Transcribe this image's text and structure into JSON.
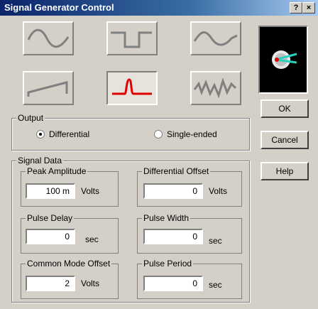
{
  "window": {
    "title": "Signal Generator Control",
    "help_label": "?",
    "close_label": "×"
  },
  "waveforms": [
    {
      "name": "sine",
      "selected": false
    },
    {
      "name": "square",
      "selected": false
    },
    {
      "name": "triangle",
      "selected": false
    },
    {
      "name": "ramp",
      "selected": false
    },
    {
      "name": "pulse",
      "selected": true
    },
    {
      "name": "noise",
      "selected": false
    }
  ],
  "output": {
    "legend": "Output",
    "options": [
      {
        "label": "Differential",
        "selected": true
      },
      {
        "label": "Single-ended",
        "selected": false
      }
    ]
  },
  "signal_data": {
    "legend": "Signal Data",
    "fields": {
      "peak_amplitude": {
        "label": "Peak Amplitude",
        "value": "100 m",
        "unit": "Volts"
      },
      "differential_offset": {
        "label": "Differential Offset",
        "value": "0",
        "unit": "Volts"
      },
      "pulse_delay": {
        "label": "Pulse Delay",
        "value": "0",
        "unit": "sec"
      },
      "pulse_width": {
        "label": "Pulse Width",
        "value": "0",
        "unit": "sec"
      },
      "common_mode_offset": {
        "label": "Common Mode Offset",
        "value": "2",
        "unit": "Volts"
      },
      "pulse_period": {
        "label": "Pulse Period",
        "value": "0",
        "unit": "sec"
      }
    }
  },
  "buttons": {
    "ok": "OK",
    "cancel": "Cancel",
    "help": "Help"
  },
  "colors": {
    "wave_grey": "#808080",
    "wave_selected": "#e00000",
    "title_bar": "#0a246a"
  }
}
